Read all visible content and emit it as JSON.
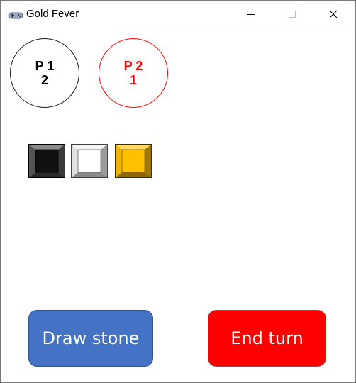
{
  "window": {
    "title": "Gold Fever"
  },
  "players": [
    {
      "label": "P 1",
      "score": "2",
      "color": "#000000"
    },
    {
      "label": "P 2",
      "score": "1",
      "color": "#ff0000"
    }
  ],
  "stones": [
    {
      "name": "black-stone",
      "color": "#111111"
    },
    {
      "name": "white-stone",
      "color": "#ffffff"
    },
    {
      "name": "gold-stone",
      "color": "#ffc000"
    }
  ],
  "actions": {
    "draw_label": "Draw stone",
    "draw_color": "#4472c4",
    "end_label": "End turn",
    "end_color": "#ff0000"
  }
}
